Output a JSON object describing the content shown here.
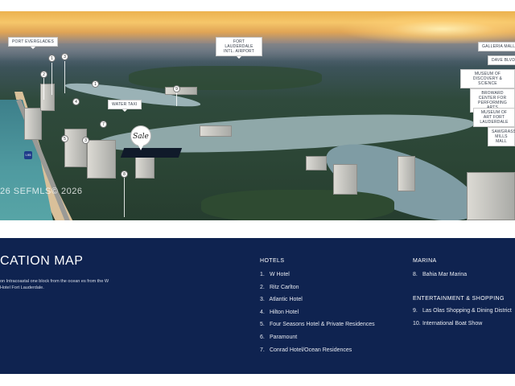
{
  "map": {
    "labels": {
      "port_everglades": "PORT EVERGLADES",
      "airport": "FORT LAUDERDALE INTL. AIRPORT",
      "galleria_mall": "GALLERIA MALL",
      "dave_blvd": "DAVE BLVD",
      "museum_discovery": "MUSEUM OF DISCOVERY & SCIENCE",
      "broward_center": "BROWARD CENTER FOR PERFORMING ARTS",
      "museum_art": "MUSEUM OF ART FORT LAUDERDALE",
      "sawgrass": "SAWGRASS MILLS MALL",
      "water_taxi": "WATER TAXI"
    },
    "pins": [
      "1",
      "2",
      "3",
      "4",
      "5",
      "6",
      "7",
      "8",
      "9",
      "10"
    ],
    "property_logo": "Sale",
    "watermark": "26 SEFMLS© 2026",
    "highway_shield": "I-95"
  },
  "panel": {
    "title": "CATION MAP",
    "description": "on Intracoastal one block from the ocean es from the W Hotel Fort Lauderdale.",
    "hotels": {
      "heading": "HOTELS",
      "items": [
        {
          "num": "1.",
          "label": "W Hotel"
        },
        {
          "num": "2.",
          "label": "Ritz Carlton"
        },
        {
          "num": "3.",
          "label": "Atlantic Hotel"
        },
        {
          "num": "4.",
          "label": "Hilton Hotel"
        },
        {
          "num": "5.",
          "label": "Four Seasons Hotel & Private Residences"
        },
        {
          "num": "6.",
          "label": "Paramount"
        },
        {
          "num": "7.",
          "label": "Conrad Hotel/Ocean Residences"
        }
      ]
    },
    "marina": {
      "heading": "MARINA",
      "items": [
        {
          "num": "8.",
          "label": "Bahia Mar Marina"
        }
      ]
    },
    "entertainment": {
      "heading": "ENTERTAINMENT & SHOPPING",
      "items": [
        {
          "num": "9.",
          "label": "Las Olas Shopping & Dining District"
        },
        {
          "num": "10.",
          "label": "International Boat Show"
        }
      ]
    }
  }
}
